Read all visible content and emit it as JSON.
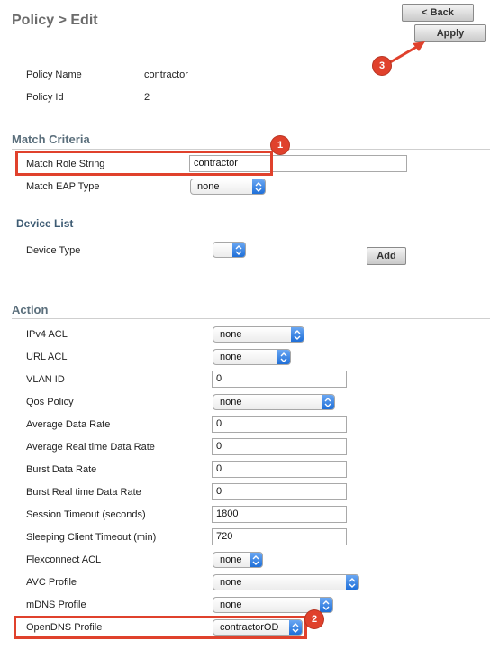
{
  "header": {
    "title": "Policy > Edit",
    "back_label": "< Back",
    "apply_label": "Apply"
  },
  "policy": {
    "name_label": "Policy Name",
    "name_value": "contractor",
    "id_label": "Policy Id",
    "id_value": "2"
  },
  "match_criteria": {
    "heading": "Match Criteria",
    "role_string_label": "Match Role String",
    "role_string_value": "contractor",
    "eap_type_label": "Match EAP Type",
    "eap_type_value": "none"
  },
  "device_list": {
    "heading": "Device List",
    "device_type_label": "Device Type",
    "device_type_value": "",
    "add_label": "Add"
  },
  "action": {
    "heading": "Action",
    "ipv4_acl": {
      "label": "IPv4 ACL",
      "value": "none"
    },
    "url_acl": {
      "label": "URL ACL",
      "value": "none"
    },
    "vlan_id": {
      "label": "VLAN ID",
      "value": "0"
    },
    "qos_policy": {
      "label": "Qos Policy",
      "value": "none"
    },
    "avg_data_rate": {
      "label": "Average Data Rate",
      "value": "0"
    },
    "avg_rt_data_rate": {
      "label": "Average Real time Data Rate",
      "value": "0"
    },
    "burst_data_rate": {
      "label": "Burst Data Rate",
      "value": "0"
    },
    "burst_rt_data_rate": {
      "label": "Burst Real time Data Rate",
      "value": "0"
    },
    "session_timeout": {
      "label": "Session Timeout (seconds)",
      "value": "1800"
    },
    "sleeping_timeout": {
      "label": "Sleeping Client Timeout (min)",
      "value": "720"
    },
    "flexconnect_acl": {
      "label": "Flexconnect ACL",
      "value": "none"
    },
    "avc_profile": {
      "label": "AVC Profile",
      "value": "none"
    },
    "mdns_profile": {
      "label": "mDNS Profile",
      "value": "none"
    },
    "opendns_profile": {
      "label": "OpenDNS Profile",
      "value": "contractorOD"
    }
  },
  "annotations": {
    "badge_1": "1",
    "badge_2": "2",
    "badge_3": "3",
    "highlight_color": "#e0412c"
  }
}
